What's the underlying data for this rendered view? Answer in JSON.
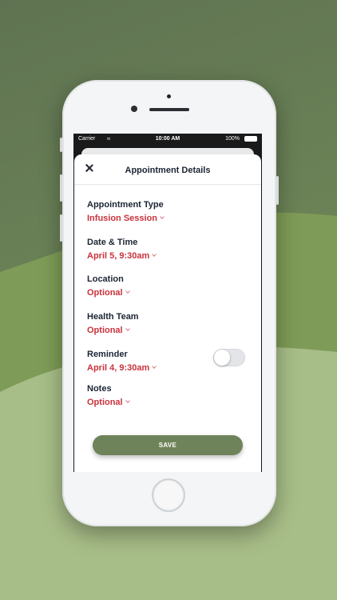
{
  "status_bar": {
    "carrier": "Carrier",
    "time": "10:00 AM",
    "battery": "100%"
  },
  "header": {
    "title": "Appointment Details",
    "close_icon": "close-icon"
  },
  "fields": [
    {
      "label": "Appointment Type",
      "value": "Infusion Session"
    },
    {
      "label": "Date & Time",
      "value": "April 5, 9:30am"
    },
    {
      "label": "Location",
      "value": "Optional"
    },
    {
      "label": "Health Team",
      "value": "Optional"
    },
    {
      "label": "Reminder",
      "value": "April 4, 9:30am",
      "toggle_on": false
    },
    {
      "label": "Notes",
      "value": "Optional"
    }
  ],
  "save_label": "SAVE",
  "colors": {
    "accent": "#6e8359",
    "value_red": "#c8323c",
    "heading": "#1c2533",
    "background_green": "#6f8a58"
  }
}
